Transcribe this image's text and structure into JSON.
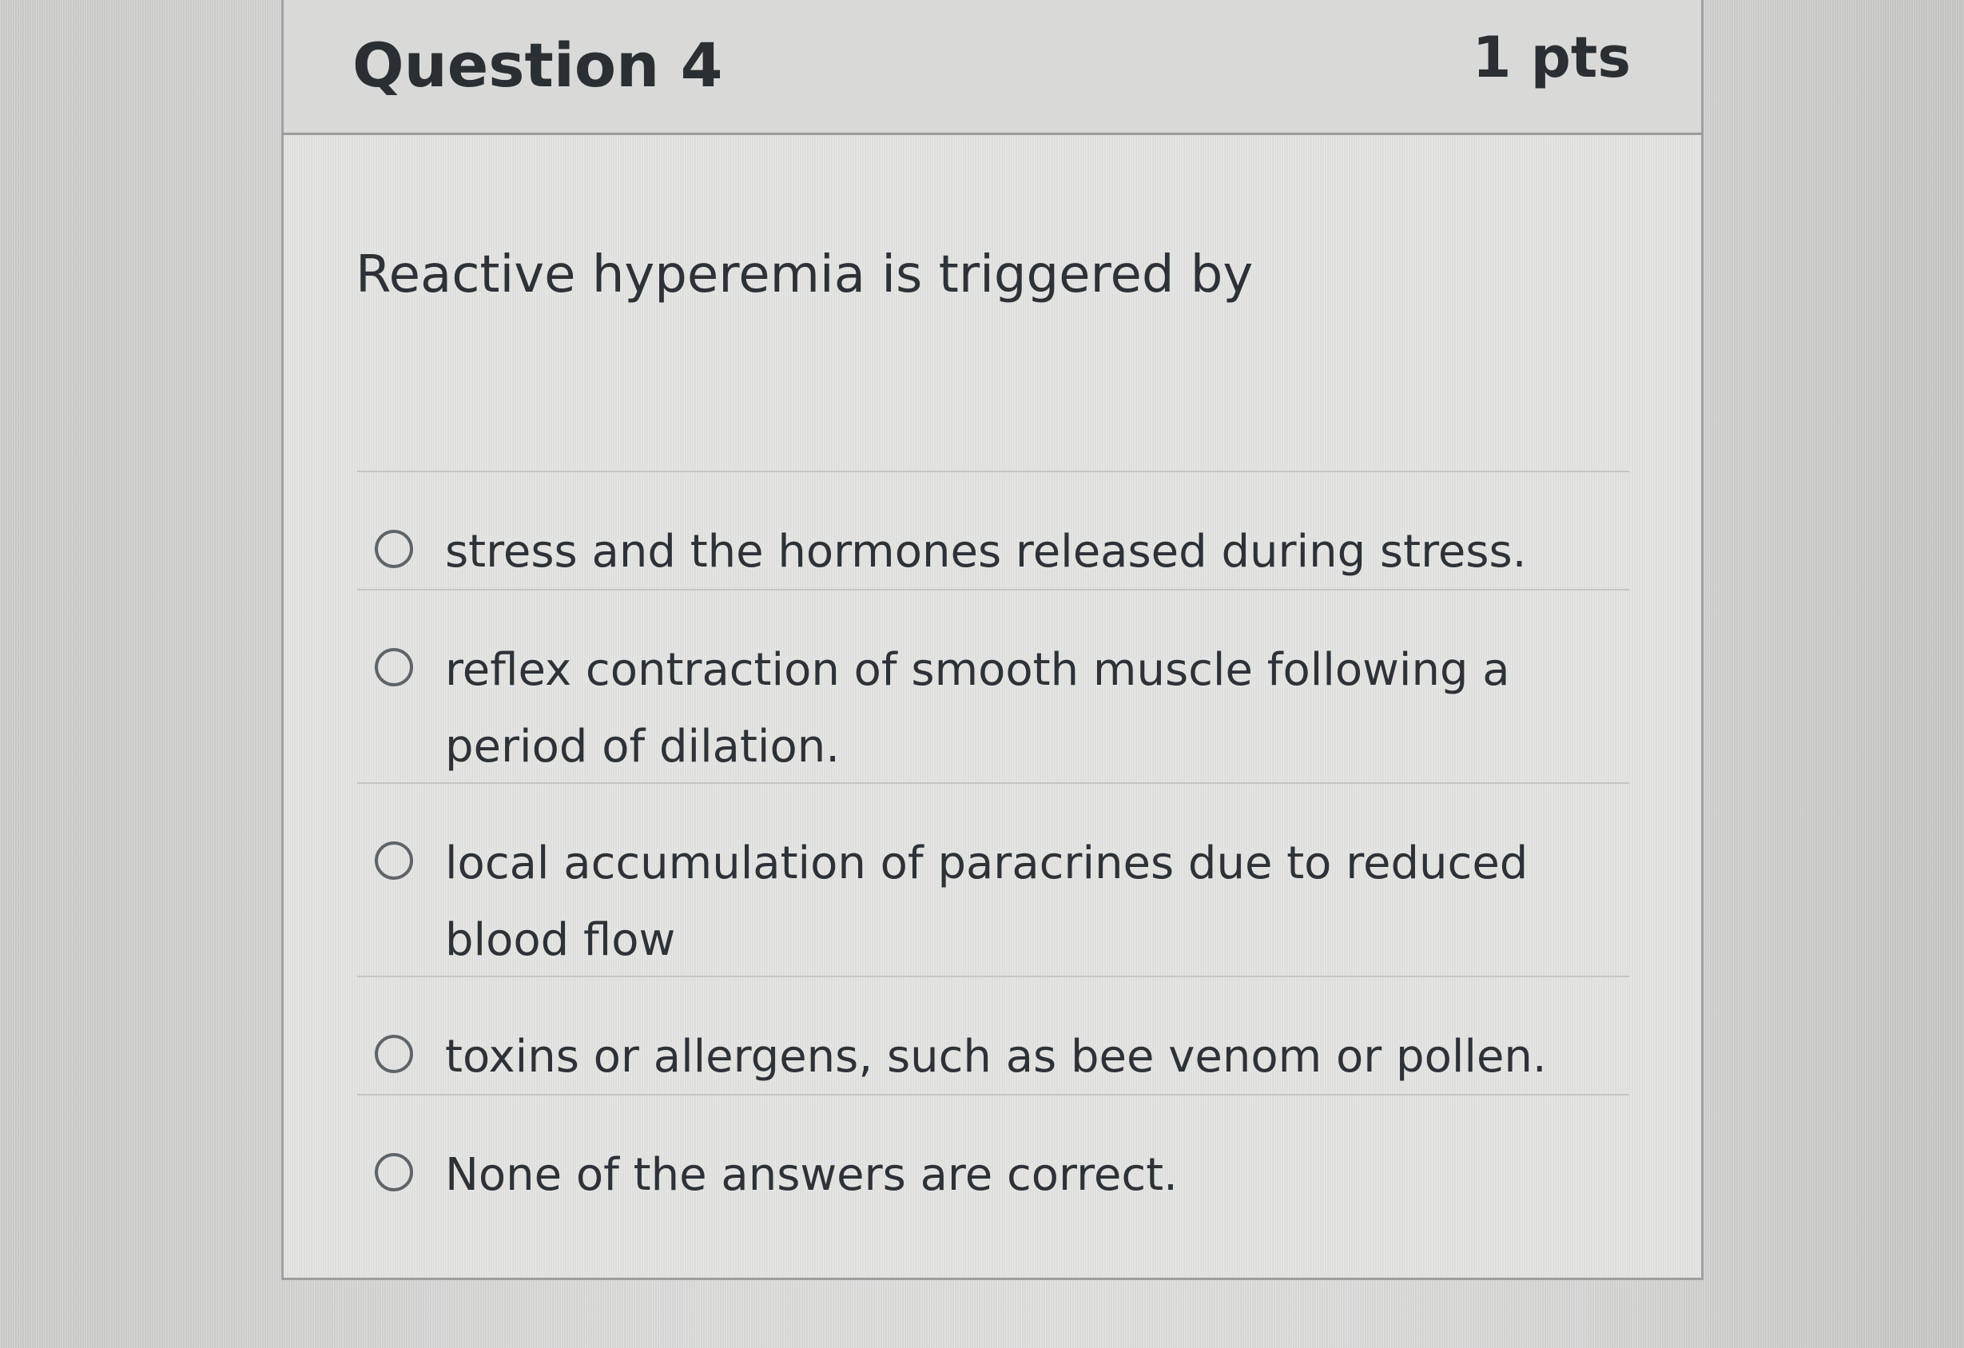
{
  "question": {
    "title": "Question 4",
    "points": "1 pts",
    "prompt": "Reactive hyperemia is triggered by",
    "answers": [
      {
        "label": "stress and the hormones released during stress.",
        "selected": false
      },
      {
        "label": "reflex contraction of smooth muscle following a period of dilation.",
        "selected": false
      },
      {
        "label": "local accumulation of paracrines due to reduced blood flow",
        "selected": false
      },
      {
        "label": "toxins or allergens, such as bee venom or pollen.",
        "selected": false
      },
      {
        "label": "None of the answers are correct.",
        "selected": false
      }
    ]
  }
}
